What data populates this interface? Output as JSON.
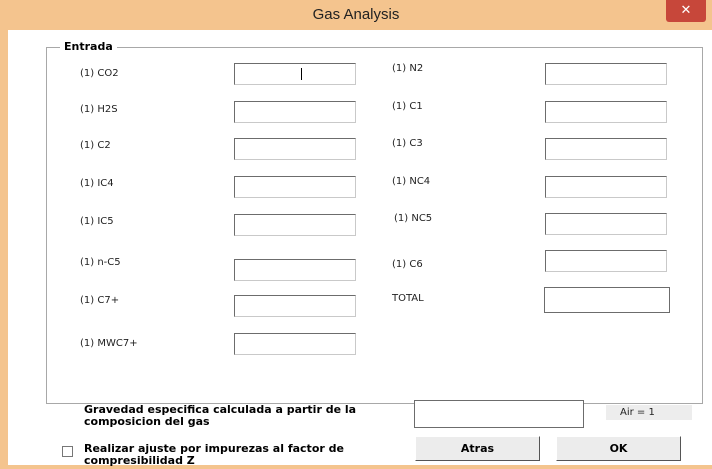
{
  "window": {
    "title": "Gas Analysis",
    "close_symbol": "✕"
  },
  "entrada": {
    "label": "Entrada",
    "left_fields": [
      {
        "label": "(1) CO2",
        "value": ""
      },
      {
        "label": "(1) H2S",
        "value": ""
      },
      {
        "label": "(1) C2",
        "value": ""
      },
      {
        "label": "(1) IC4",
        "value": ""
      },
      {
        "label": "(1) IC5",
        "value": ""
      },
      {
        "label": "(1) n-C5",
        "value": ""
      },
      {
        "label": "(1) C7+",
        "value": ""
      },
      {
        "label": "(1) MWC7+",
        "value": ""
      }
    ],
    "right_fields": [
      {
        "label": "(1) N2",
        "value": ""
      },
      {
        "label": "(1) C1",
        "value": ""
      },
      {
        "label": "(1) C3",
        "value": ""
      },
      {
        "label": "(1) NC4",
        "value": ""
      },
      {
        "label": "(1) NC5",
        "value": ""
      },
      {
        "label": "(1) C6",
        "value": ""
      }
    ],
    "total": {
      "label": "TOTAL",
      "value": ""
    }
  },
  "gravedad": {
    "label": "Gravedad especifica calculada a partir de la composicion del gas",
    "value": "",
    "unit_note": "Air = 1"
  },
  "ajuste": {
    "label": "Realizar ajuste por impurezas al factor de compresibilidad Z",
    "checked": false
  },
  "buttons": {
    "back": "Atras",
    "ok": "OK"
  }
}
